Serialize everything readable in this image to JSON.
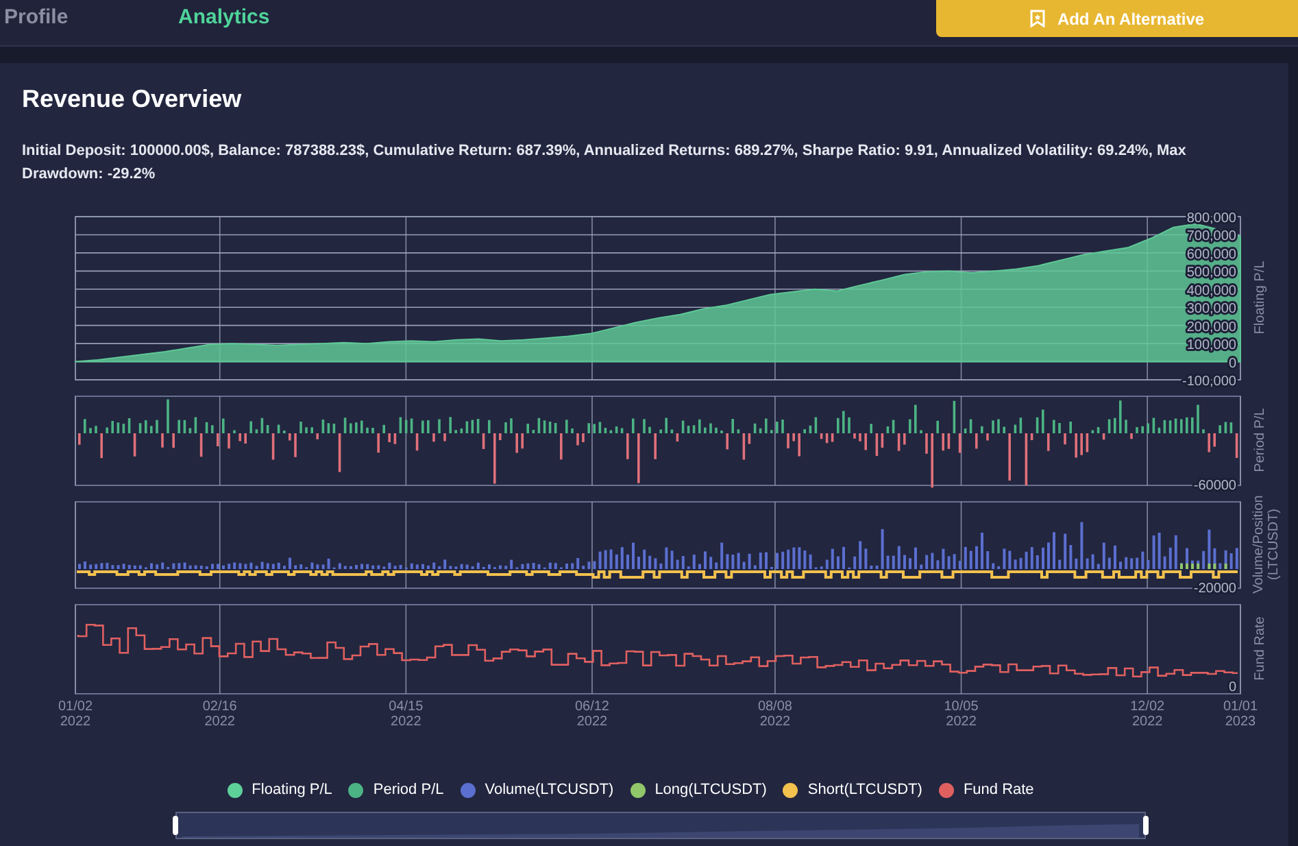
{
  "tabs": [
    {
      "label": "Profile",
      "selected": false
    },
    {
      "label": "Analytics",
      "selected": true
    }
  ],
  "add_button": {
    "label": "Add An Alternative"
  },
  "card": {
    "title": "Revenue Overview",
    "summary": "Initial Deposit: 100000.00$, Balance: 787388.23$, Cumulative Return: 687.39%, Annualized Returns: 689.27%, Sharpe Ratio: 9.91, Annualized Volatility: 69.24%, Max Drawdown: -29.2%"
  },
  "floating_pl": {
    "chart_data": {
      "type": "area",
      "ylabel": "Floating P/L",
      "ylim": [
        -100000,
        800000
      ],
      "yticks": [
        {
          "value": 800000,
          "label": "800,000"
        },
        {
          "value": 700000,
          "label": "700,000"
        },
        {
          "value": 600000,
          "label": "600,000"
        },
        {
          "value": 500000,
          "label": "500,000"
        },
        {
          "value": 400000,
          "label": "400,000"
        },
        {
          "value": 300000,
          "label": "300,000"
        },
        {
          "value": 200000,
          "label": "200,000"
        },
        {
          "value": 100000,
          "label": "100,000"
        },
        {
          "value": 0,
          "label": "0"
        },
        {
          "value": -100000,
          "label": "-100,000"
        }
      ],
      "grid": true,
      "series": [
        {
          "color": "#5ec795",
          "values": [
            0,
            10000,
            25000,
            40000,
            55000,
            75000,
            95000,
            100000,
            95000,
            90000,
            95000,
            100000,
            105000,
            100000,
            110000,
            115000,
            110000,
            120000,
            125000,
            115000,
            120000,
            130000,
            140000,
            155000,
            185000,
            215000,
            240000,
            260000,
            290000,
            310000,
            340000,
            370000,
            385000,
            400000,
            390000,
            420000,
            450000,
            480000,
            495000,
            500000,
            490000,
            500000,
            510000,
            530000,
            560000,
            590000,
            610000,
            630000,
            680000,
            740000,
            760000,
            730000,
            690000
          ]
        }
      ]
    }
  },
  "period_pl": {
    "ylabel": "Period P/L",
    "ytick": "-60000"
  },
  "volume_position": {
    "ylabel": [
      "Volume/Position",
      "(LTCUSDT)"
    ],
    "ytick": "-20000"
  },
  "fund_rate": {
    "ylabel": "Fund Rate",
    "ytick": "0"
  },
  "x_axis": [
    {
      "date": "01/02",
      "year": "2022"
    },
    {
      "date": "02/16",
      "year": "2022"
    },
    {
      "date": "04/15",
      "year": "2022"
    },
    {
      "date": "06/12",
      "year": "2022"
    },
    {
      "date": "08/08",
      "year": "2022"
    },
    {
      "date": "10/05",
      "year": "2022"
    },
    {
      "date": "12/02",
      "year": "2022"
    },
    {
      "date": "01/01",
      "year": "2023"
    }
  ],
  "zoom_slider": {
    "level": 1
  },
  "legend": [
    {
      "label": "Floating P/L",
      "color": "#5ed19a"
    },
    {
      "label": "Period P/L",
      "color": "#4cb484"
    },
    {
      "label": "Volume(LTCUSDT)",
      "color": "#5b6fd0"
    },
    {
      "label": "Long(LTCUSDT)",
      "color": "#91c76a"
    },
    {
      "label": "Short(LTCUSDT)",
      "color": "#f2c14e"
    },
    {
      "label": "Fund Rate",
      "color": "#e06060"
    }
  ]
}
